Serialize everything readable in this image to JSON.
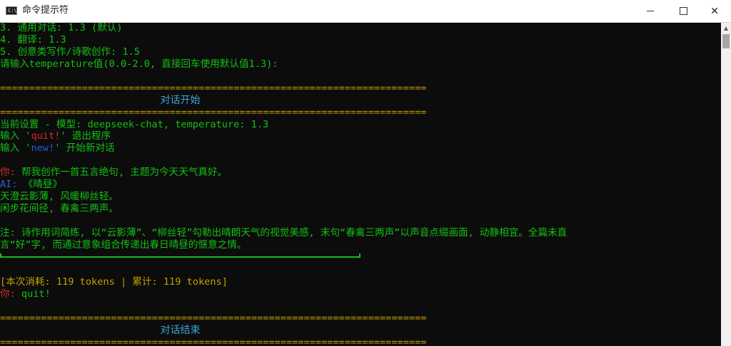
{
  "window": {
    "title": "命令提示符",
    "app_icon_text": "C:\\",
    "minimize_icon": "minimize-icon",
    "maximize_icon": "maximize-icon",
    "close_icon": "close-icon"
  },
  "terminal": {
    "options": [
      "3. 通用对话: 1.3 (默认)",
      "4. 翻译: 1.3",
      "5. 创意类写作/诗歌创作: 1.5"
    ],
    "temperature_prompt": "请输入temperature值(0.0-2.0, 直接回车使用默认值1.3):",
    "separator": "=========================================================================",
    "header_start": "对话开始",
    "settings_line": "当前设置 - 模型: deepseek-chat, temperature: 1.3",
    "quit_prefix": "输入 '",
    "quit_cmd": "quit!",
    "quit_suffix": "' 退出程序",
    "new_prefix": "输入 '",
    "new_cmd": "new!",
    "new_suffix": "' 开始新对话",
    "user_label": "你:",
    "user_msg": " 帮我创作一首五言绝句, 主题为今天天气真好。",
    "ai_label": "AI:",
    "ai_title": " 《晴昼》",
    "poem_line1": "天澄云影薄, 风暖柳丝轻。",
    "poem_line2": "闲步花间径, 春禽三两声。",
    "note_line1": "注: 诗作用词简练, 以“云影薄”、“柳丝轻”勾勒出晴朗天气的视觉美感, 末句“春禽三两声”以声音点缀画面, 动静相宜。全篇未直",
    "note_line2": "言“好”字, 而通过意象组合传递出春日晴昼的惬意之情。",
    "tokens_line": "[本次消耗: 119 tokens | 累计: 119 tokens]",
    "user_label2": "你:",
    "user_quit": " quit!",
    "header_end": "对话结束"
  },
  "colors": {
    "background": "#0c0c0c",
    "text_green": "#13c013",
    "text_yellow": "#c0a000",
    "text_cyan": "#3aa6d6",
    "text_red": "#d22a2a",
    "text_blue": "#2f5bd8"
  }
}
